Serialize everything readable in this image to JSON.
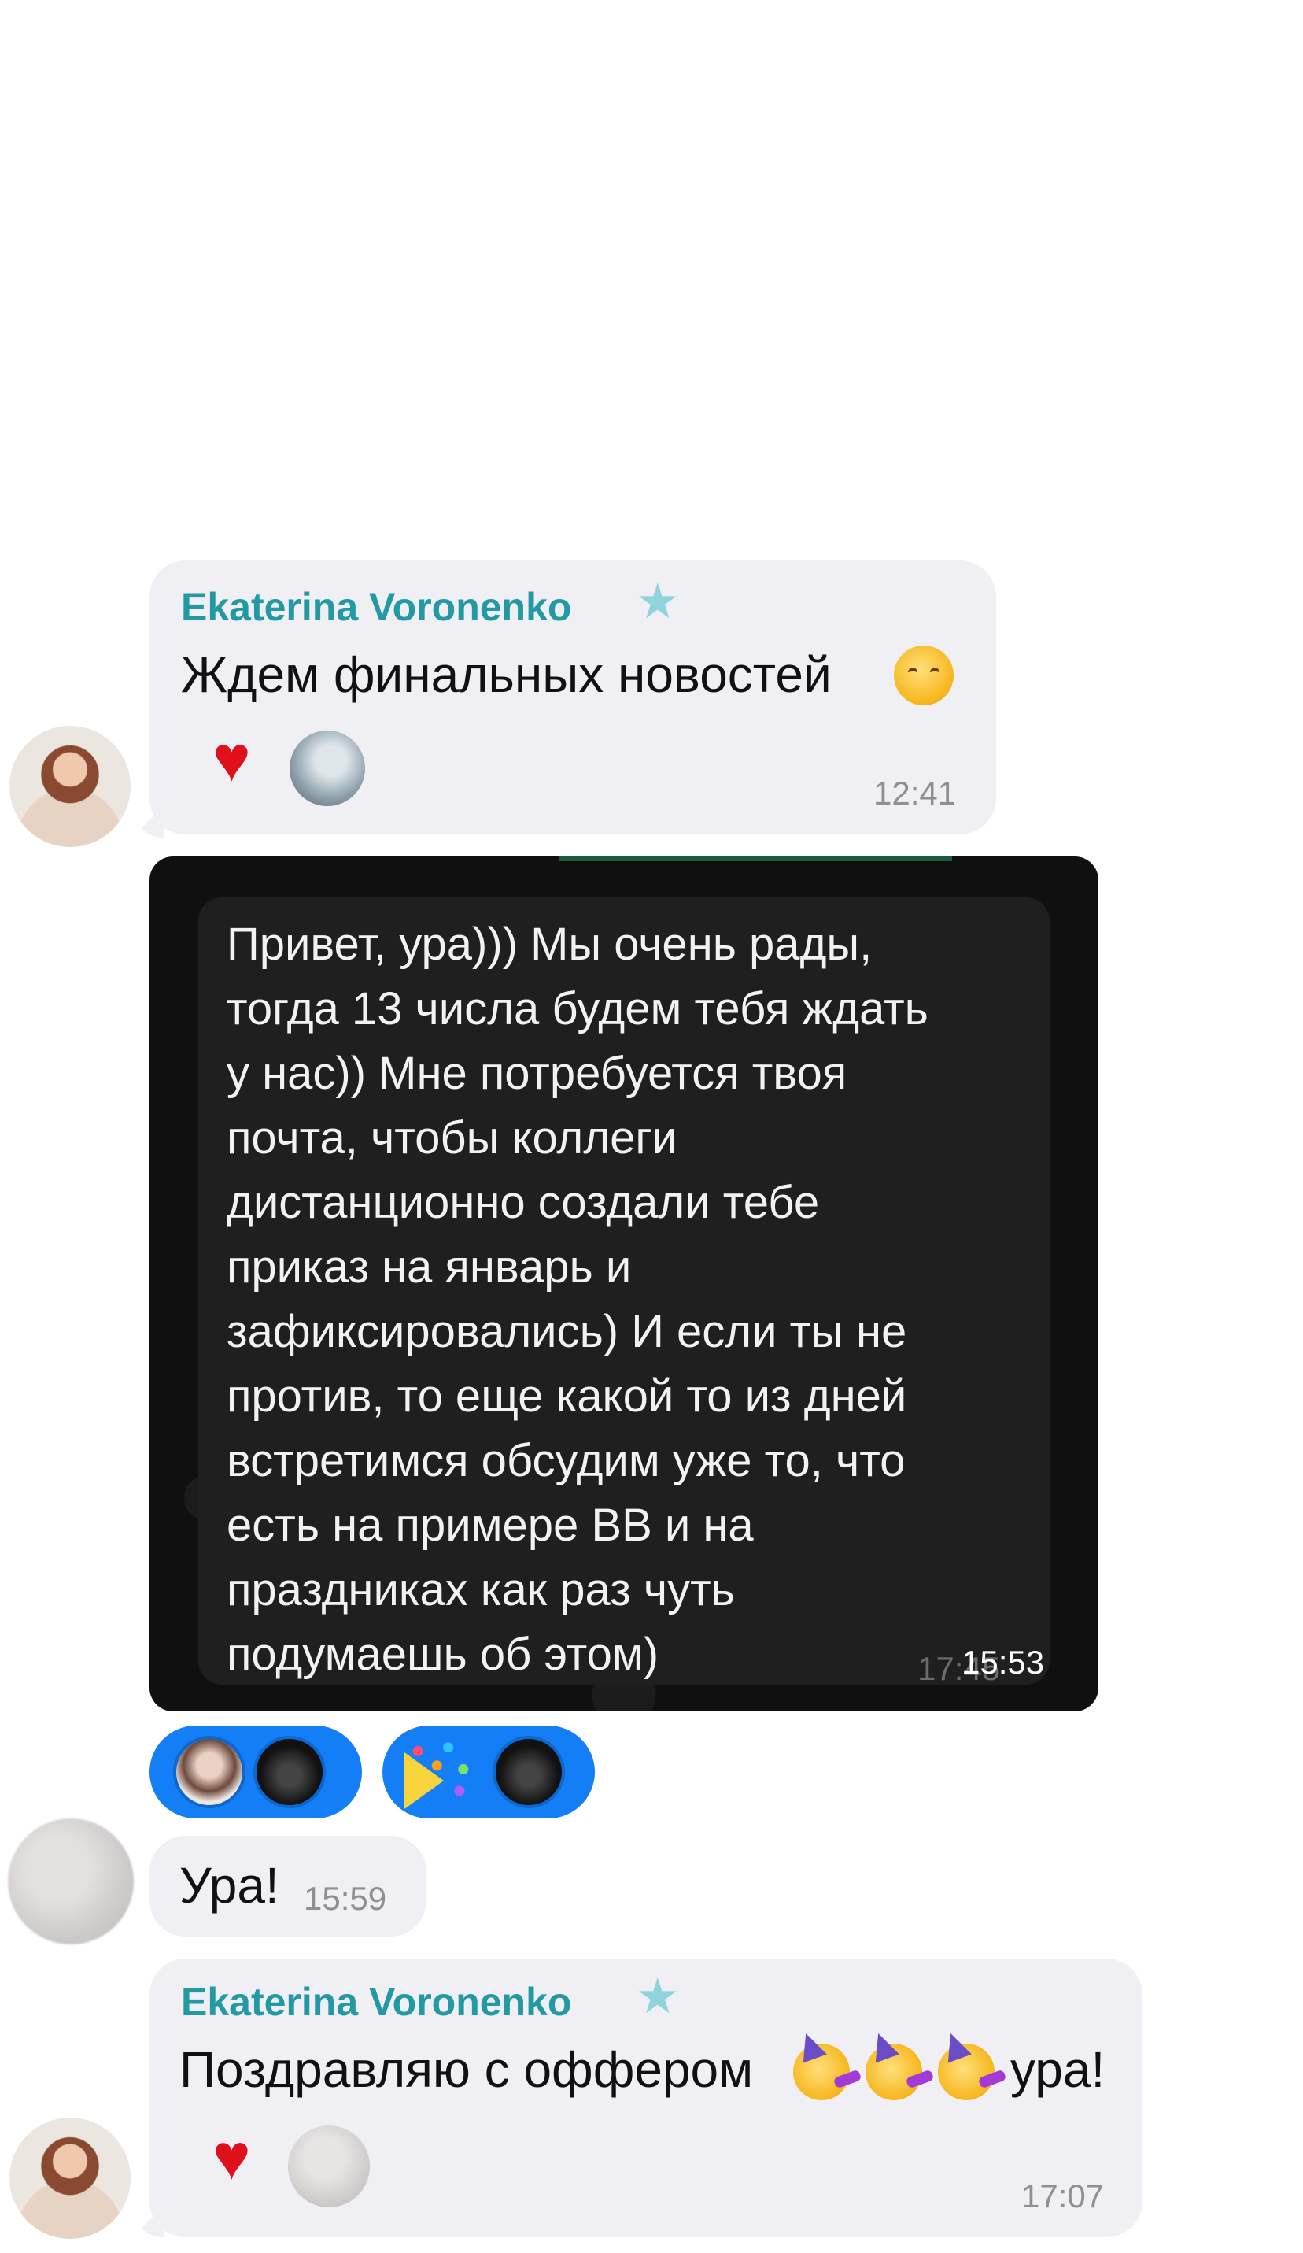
{
  "messages": [
    {
      "sender": "Ekaterina Voronenko",
      "text": "Ждем финальных новостей",
      "time": "12:41",
      "reactions": [
        "heart-emoji",
        "user-avatar"
      ]
    },
    {
      "forwarded_lines": [
        "Привет, ура))) Мы очень рады,",
        "тогда 13 числа будем тебя ждать",
        "у нас)) Мне потребуется твоя",
        "почта, чтобы коллеги",
        "дистанционно создали тебе",
        "приказ на январь и",
        "зафиксировались) И если ты не",
        "против, то еще какой то из дней",
        "встретимся обсудим уже то, что",
        "есть на примере ВВ и на",
        "праздниках как раз чуть",
        "подумаешь об этом)"
      ],
      "time": "15:53",
      "time_underlay": "17:45"
    },
    {
      "text": "Ура!",
      "time": "15:59"
    },
    {
      "sender": "Ekaterina Voronenko",
      "text_before": "Поздравляю с оффером",
      "text_after": "ура!",
      "time": "17:07",
      "reactions": [
        "heart-emoji",
        "user-avatar"
      ]
    }
  ],
  "colors": {
    "sender": "#2399a3",
    "bubble": "#efeff4",
    "reaction_pill": "#137ef5",
    "time": "#8e8e93"
  }
}
